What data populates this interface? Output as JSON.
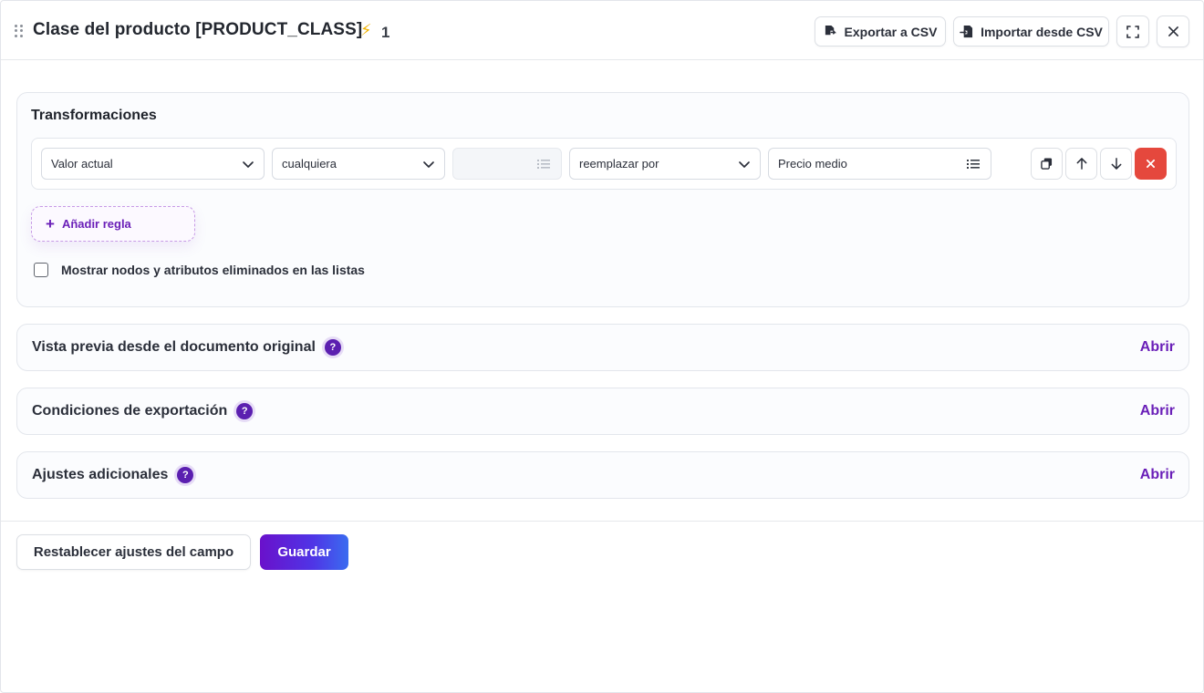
{
  "header": {
    "title": "Clase del producto [PRODUCT_CLASS]",
    "bolt_icon": "lightning-icon",
    "bolt_count": "1",
    "export_label": "Exportar a CSV",
    "import_label": "Importar desde CSV"
  },
  "transformations": {
    "title": "Transformaciones",
    "rule": {
      "field1": "Valor actual",
      "field2": "cualquiera",
      "field3": "",
      "field4": "reemplazar por",
      "field5": "Precio medio"
    },
    "add_rule_label": "Añadir regla",
    "show_deleted_label": "Mostrar nodos y atributos eliminados en las listas"
  },
  "sections": [
    {
      "title": "Vista previa desde el documento original",
      "help": "?",
      "action": "Abrir"
    },
    {
      "title": "Condiciones de exportación",
      "help": "?",
      "action": "Abrir"
    },
    {
      "title": "Ajustes adicionales",
      "help": "?",
      "action": "Abrir"
    }
  ],
  "footer": {
    "reset_label": "Restablecer ajustes del campo",
    "save_label": "Guardar"
  },
  "colors": {
    "accent": "#6a1fb8",
    "danger": "#e5483d",
    "bolt": "#f2b300"
  }
}
